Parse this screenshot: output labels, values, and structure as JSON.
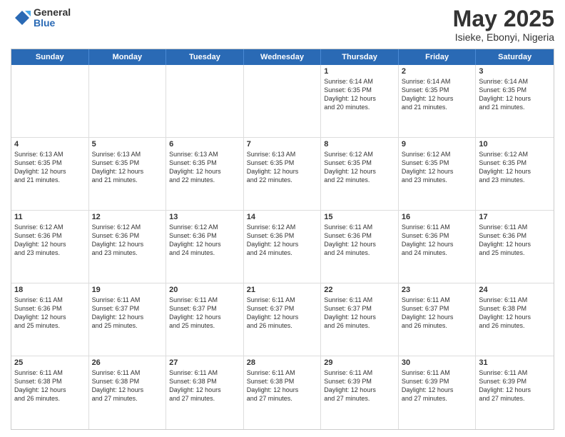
{
  "logo": {
    "general": "General",
    "blue": "Blue"
  },
  "title": "May 2025",
  "location": "Isieke, Ebonyi, Nigeria",
  "header_days": [
    "Sunday",
    "Monday",
    "Tuesday",
    "Wednesday",
    "Thursday",
    "Friday",
    "Saturday"
  ],
  "weeks": [
    [
      {
        "day": "",
        "info": ""
      },
      {
        "day": "",
        "info": ""
      },
      {
        "day": "",
        "info": ""
      },
      {
        "day": "",
        "info": ""
      },
      {
        "day": "1",
        "info": "Sunrise: 6:14 AM\nSunset: 6:35 PM\nDaylight: 12 hours\nand 20 minutes."
      },
      {
        "day": "2",
        "info": "Sunrise: 6:14 AM\nSunset: 6:35 PM\nDaylight: 12 hours\nand 21 minutes."
      },
      {
        "day": "3",
        "info": "Sunrise: 6:14 AM\nSunset: 6:35 PM\nDaylight: 12 hours\nand 21 minutes."
      }
    ],
    [
      {
        "day": "4",
        "info": "Sunrise: 6:13 AM\nSunset: 6:35 PM\nDaylight: 12 hours\nand 21 minutes."
      },
      {
        "day": "5",
        "info": "Sunrise: 6:13 AM\nSunset: 6:35 PM\nDaylight: 12 hours\nand 21 minutes."
      },
      {
        "day": "6",
        "info": "Sunrise: 6:13 AM\nSunset: 6:35 PM\nDaylight: 12 hours\nand 22 minutes."
      },
      {
        "day": "7",
        "info": "Sunrise: 6:13 AM\nSunset: 6:35 PM\nDaylight: 12 hours\nand 22 minutes."
      },
      {
        "day": "8",
        "info": "Sunrise: 6:12 AM\nSunset: 6:35 PM\nDaylight: 12 hours\nand 22 minutes."
      },
      {
        "day": "9",
        "info": "Sunrise: 6:12 AM\nSunset: 6:35 PM\nDaylight: 12 hours\nand 23 minutes."
      },
      {
        "day": "10",
        "info": "Sunrise: 6:12 AM\nSunset: 6:35 PM\nDaylight: 12 hours\nand 23 minutes."
      }
    ],
    [
      {
        "day": "11",
        "info": "Sunrise: 6:12 AM\nSunset: 6:36 PM\nDaylight: 12 hours\nand 23 minutes."
      },
      {
        "day": "12",
        "info": "Sunrise: 6:12 AM\nSunset: 6:36 PM\nDaylight: 12 hours\nand 23 minutes."
      },
      {
        "day": "13",
        "info": "Sunrise: 6:12 AM\nSunset: 6:36 PM\nDaylight: 12 hours\nand 24 minutes."
      },
      {
        "day": "14",
        "info": "Sunrise: 6:12 AM\nSunset: 6:36 PM\nDaylight: 12 hours\nand 24 minutes."
      },
      {
        "day": "15",
        "info": "Sunrise: 6:11 AM\nSunset: 6:36 PM\nDaylight: 12 hours\nand 24 minutes."
      },
      {
        "day": "16",
        "info": "Sunrise: 6:11 AM\nSunset: 6:36 PM\nDaylight: 12 hours\nand 24 minutes."
      },
      {
        "day": "17",
        "info": "Sunrise: 6:11 AM\nSunset: 6:36 PM\nDaylight: 12 hours\nand 25 minutes."
      }
    ],
    [
      {
        "day": "18",
        "info": "Sunrise: 6:11 AM\nSunset: 6:36 PM\nDaylight: 12 hours\nand 25 minutes."
      },
      {
        "day": "19",
        "info": "Sunrise: 6:11 AM\nSunset: 6:37 PM\nDaylight: 12 hours\nand 25 minutes."
      },
      {
        "day": "20",
        "info": "Sunrise: 6:11 AM\nSunset: 6:37 PM\nDaylight: 12 hours\nand 25 minutes."
      },
      {
        "day": "21",
        "info": "Sunrise: 6:11 AM\nSunset: 6:37 PM\nDaylight: 12 hours\nand 26 minutes."
      },
      {
        "day": "22",
        "info": "Sunrise: 6:11 AM\nSunset: 6:37 PM\nDaylight: 12 hours\nand 26 minutes."
      },
      {
        "day": "23",
        "info": "Sunrise: 6:11 AM\nSunset: 6:37 PM\nDaylight: 12 hours\nand 26 minutes."
      },
      {
        "day": "24",
        "info": "Sunrise: 6:11 AM\nSunset: 6:38 PM\nDaylight: 12 hours\nand 26 minutes."
      }
    ],
    [
      {
        "day": "25",
        "info": "Sunrise: 6:11 AM\nSunset: 6:38 PM\nDaylight: 12 hours\nand 26 minutes."
      },
      {
        "day": "26",
        "info": "Sunrise: 6:11 AM\nSunset: 6:38 PM\nDaylight: 12 hours\nand 27 minutes."
      },
      {
        "day": "27",
        "info": "Sunrise: 6:11 AM\nSunset: 6:38 PM\nDaylight: 12 hours\nand 27 minutes."
      },
      {
        "day": "28",
        "info": "Sunrise: 6:11 AM\nSunset: 6:38 PM\nDaylight: 12 hours\nand 27 minutes."
      },
      {
        "day": "29",
        "info": "Sunrise: 6:11 AM\nSunset: 6:39 PM\nDaylight: 12 hours\nand 27 minutes."
      },
      {
        "day": "30",
        "info": "Sunrise: 6:11 AM\nSunset: 6:39 PM\nDaylight: 12 hours\nand 27 minutes."
      },
      {
        "day": "31",
        "info": "Sunrise: 6:11 AM\nSunset: 6:39 PM\nDaylight: 12 hours\nand 27 minutes."
      }
    ]
  ]
}
